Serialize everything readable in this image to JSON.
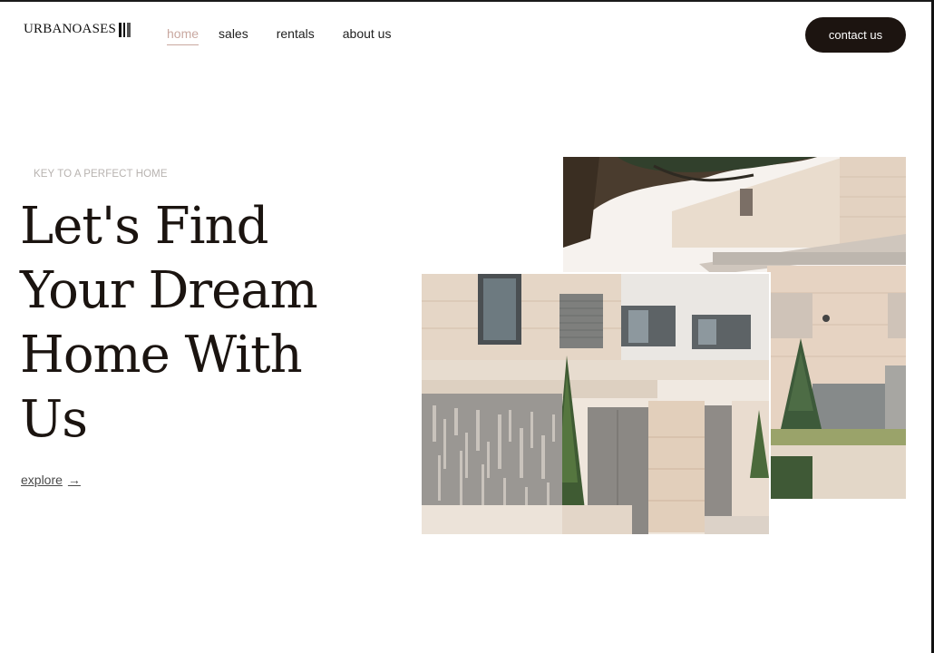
{
  "brand": {
    "name": "URBANOASES"
  },
  "nav": {
    "items": [
      {
        "label": "home",
        "active": true
      },
      {
        "label": "sales",
        "active": false
      },
      {
        "label": "rentals",
        "active": false
      },
      {
        "label": "about us",
        "active": false
      }
    ]
  },
  "header": {
    "contact_label": "contact us"
  },
  "hero": {
    "eyebrow": "KEY TO A PERFECT HOME",
    "headline_lines": [
      "Let's Find",
      "Your Dream",
      "Home With",
      "Us"
    ],
    "explore_label": "explore",
    "explore_arrow": "→"
  },
  "images": {
    "back_image": "modern-house-exterior-photo",
    "front_image": "modern-townhouse-gate-photo"
  },
  "colors": {
    "accent": "#c9a8a0",
    "button_bg": "#1c1410",
    "text_dark": "#1b1410"
  }
}
